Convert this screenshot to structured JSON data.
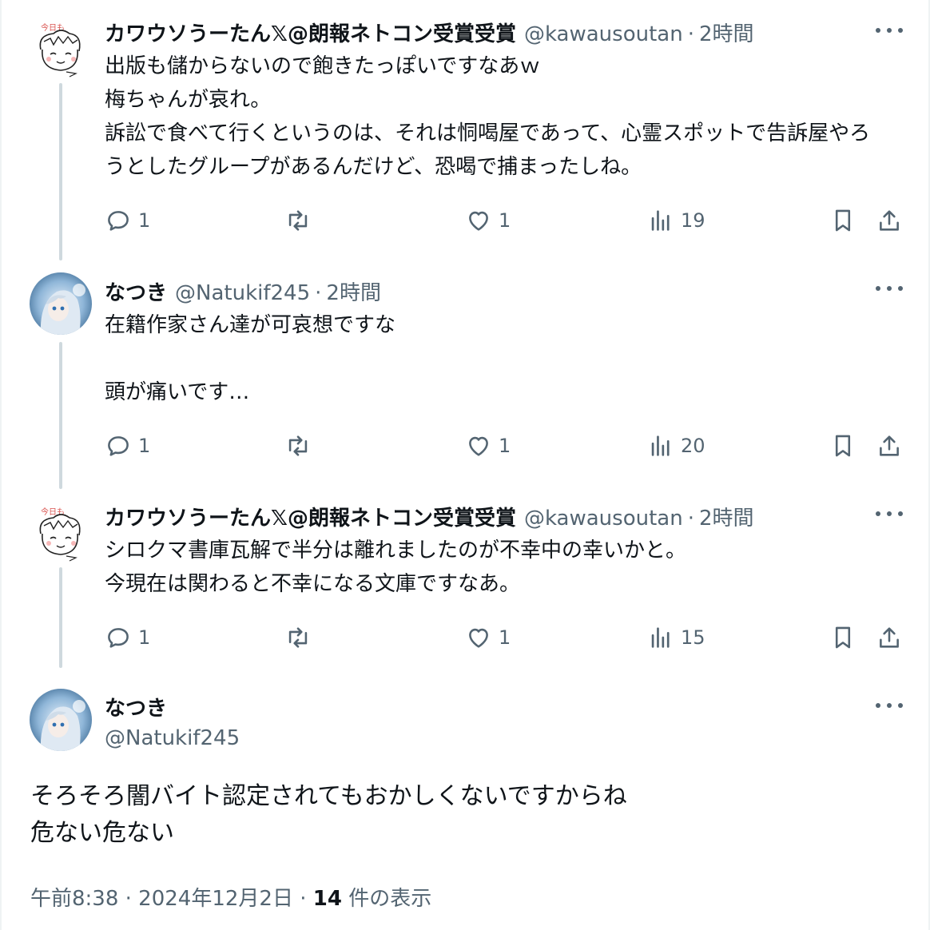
{
  "tweets": [
    {
      "name": "カワウソうーたん𝕏@朗報ネトコン受賞受賞",
      "handle": "@kawausoutan",
      "sep": "·",
      "time": "2時間",
      "lines": [
        "出版も儲からないので飽きたっぽいですなあｗ",
        "梅ちゃんが哀れ。",
        "訴訟で食べて行くというのは、それは恫喝屋であって、心霊スポットで告訴屋やろ",
        "うとしたグループがあるんだけど、恐喝で捕まったしね。"
      ],
      "reply_count": "1",
      "like_count": "1",
      "view_count": "19"
    },
    {
      "name": "なつき",
      "handle": "@Natukif245",
      "sep": "·",
      "time": "2時間",
      "lines": [
        "在籍作家さん達が可哀想ですな",
        "",
        "頭が痛いです…"
      ],
      "reply_count": "1",
      "like_count": "1",
      "view_count": "20"
    },
    {
      "name": "カワウソうーたん𝕏@朗報ネトコン受賞受賞",
      "handle": "@kawausoutan",
      "sep": "·",
      "time": "2時間",
      "lines": [
        "シロクマ書庫瓦解で半分は離れましたのが不幸中の幸いかと。",
        "今現在は関わると不幸になる文庫ですなあ。"
      ],
      "reply_count": "1",
      "like_count": "1",
      "view_count": "15"
    }
  ],
  "main_tweet": {
    "name": "なつき",
    "handle": "@Natukif245",
    "lines": [
      "そろそろ闇バイト認定されてもおかしくないですからね",
      "危ない危ない"
    ],
    "timestamp": "午前8:38 · 2024年12月2日 · ",
    "view_count": "14",
    "view_label": " 件の表示"
  },
  "icons": {
    "reply": "reply-icon",
    "retweet": "retweet-icon",
    "like": "heart-icon",
    "views": "views-icon",
    "bookmark": "bookmark-icon",
    "share": "share-icon",
    "more": "more-icon"
  },
  "colors": {
    "text": "#0f1419",
    "secondary": "#536471",
    "thread_line": "#cfd9de"
  }
}
